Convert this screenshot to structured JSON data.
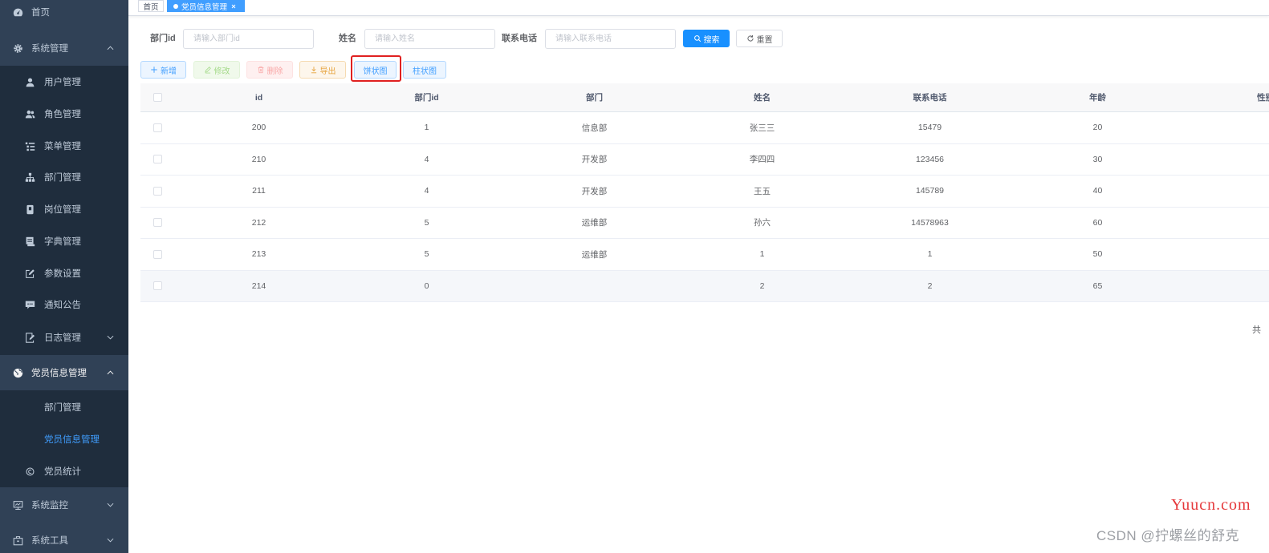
{
  "sidebar": {
    "home": {
      "label": "首页",
      "icon": "dashboard-icon"
    },
    "system": {
      "label": "系统管理",
      "icon": "gear-icon",
      "expanded": true,
      "items": [
        {
          "label": "用户管理",
          "icon": "user-icon"
        },
        {
          "label": "角色管理",
          "icon": "peoples-icon"
        },
        {
          "label": "菜单管理",
          "icon": "tree-table-icon"
        },
        {
          "label": "部门管理",
          "icon": "tree-icon"
        },
        {
          "label": "岗位管理",
          "icon": "post-icon"
        },
        {
          "label": "字典管理",
          "icon": "dict-icon"
        },
        {
          "label": "参数设置",
          "icon": "edit-icon"
        },
        {
          "label": "通知公告",
          "icon": "message-icon"
        },
        {
          "label": "日志管理",
          "icon": "log-icon",
          "has_children": true
        }
      ]
    },
    "party": {
      "label": "党员信息管理",
      "icon": "globe-icon",
      "expanded": true,
      "items": [
        {
          "label": "部门管理"
        },
        {
          "label": "党员信息管理",
          "active": true
        },
        {
          "label": "党员统计",
          "icon": "circle-icon"
        }
      ]
    },
    "monitor": {
      "label": "系统监控",
      "icon": "monitor-icon"
    },
    "tool": {
      "label": "系统工具",
      "icon": "tool-icon"
    }
  },
  "tags": {
    "home": "首页",
    "active": "党员信息管理"
  },
  "search": {
    "fields": [
      {
        "label": "部门id",
        "placeholder": "请输入部门id"
      },
      {
        "label": "姓名",
        "placeholder": "请输入姓名"
      },
      {
        "label": "联系电话",
        "placeholder": "请输入联系电话"
      }
    ],
    "search_label": "搜索",
    "reset_label": "重置"
  },
  "toolbar": {
    "add": "新增",
    "edit": "修改",
    "delete": "删除",
    "export": "导出",
    "pie": "饼状图",
    "bar": "柱状图"
  },
  "table": {
    "columns": [
      "id",
      "部门id",
      "部门",
      "姓名",
      "联系电话",
      "年龄",
      "性别"
    ],
    "rows": [
      [
        "200",
        "1",
        "信息部",
        "张三三",
        "15479",
        "20"
      ],
      [
        "210",
        "4",
        "开发部",
        "李四四",
        "123456",
        "30"
      ],
      [
        "211",
        "4",
        "开发部",
        "王五",
        "145789",
        "40"
      ],
      [
        "212",
        "5",
        "运维部",
        "孙六",
        "14578963",
        "60"
      ],
      [
        "213",
        "5",
        "运维部",
        "1",
        "1",
        "50"
      ],
      [
        "214",
        "0",
        "",
        "2",
        "2",
        "65"
      ]
    ],
    "hovered_row": 5
  },
  "pagination": {
    "total_text": "共"
  },
  "watermarks": {
    "site": "Yuucn.com",
    "author": "CSDN @拧螺丝的舒克"
  },
  "colors": {
    "accent": "#409eff",
    "sidebar_bg": "#304156",
    "submenu_bg": "#1f2d3d",
    "highlight_box": "#e02020",
    "watermark_red": "#e5383b"
  }
}
